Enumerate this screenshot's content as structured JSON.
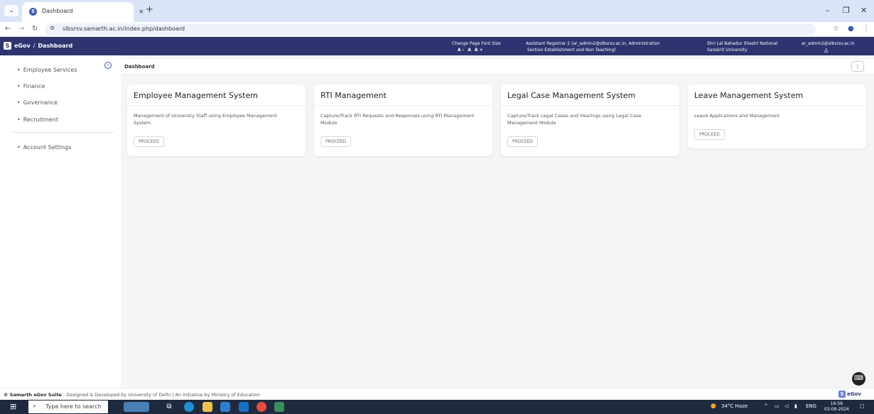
{
  "browser": {
    "tab_title": "Dashboard",
    "tab_close": "×",
    "new_tab": "+",
    "url": "slbsrsv.samarth.ac.in/index.php/dashboard",
    "icons": [
      "back-icon",
      "forward-icon",
      "reload-icon",
      "site-info-icon",
      "bookmark-star-icon",
      "profile-icon",
      "kebab-menu-icon"
    ]
  },
  "header": {
    "brand_name": "eGov",
    "brand_separator": "/",
    "page_name": "Dashboard",
    "font_size_label": "Change Page Font Size",
    "font_decrease": "A -",
    "font_reset": "A",
    "font_increase": "A +",
    "role_line1": "Assistant Registrar 2 (ar_admin2@slbsrsv.ac.in, Administration",
    "role_line2": "Section Establishment and Non Teaching)",
    "university_line1": "Shri Lal Bahadur Shastri National",
    "university_line2": "Sanskrit University",
    "user_email": "ar_admin2@slbsrsv.ac.in"
  },
  "sidebar": {
    "items": [
      {
        "label": "Employee Services"
      },
      {
        "label": "Finance"
      },
      {
        "label": "Governance"
      },
      {
        "label": "Recruitment"
      },
      {
        "label": "Account Settings"
      }
    ]
  },
  "breadcrumb": {
    "current": "Dashboard",
    "menu_glyph": "⋮"
  },
  "cards": [
    {
      "title": "Employee Management System",
      "description": "Management of University Staff using Employee Management System",
      "button": "PROCEED"
    },
    {
      "title": "RTI Management",
      "description": "Capture/Track RTI Requests and Responses using RTI Management Module",
      "button": "PROCEED"
    },
    {
      "title": "Legal Case Management System",
      "description": "Capture/Track Legal Cases and Hearings using Legal Case Management Module",
      "button": "PROCEED"
    },
    {
      "title": "Leave Management System",
      "description": "Leave Applications and Management",
      "button": "PROCEED"
    }
  ],
  "footer": {
    "brand": "© Samarth eGov Suite",
    "credit": " - Designed & Developed by University of Delhi | An Initiative by Ministry of Education",
    "badge": "eGov"
  },
  "taskbar": {
    "search_placeholder": "Type here to search",
    "weather": "34°C  Haze",
    "language": "ENG",
    "time": "16:56",
    "date": "03-09-2024"
  },
  "colors": {
    "header_bg": "#2d3470",
    "accent": "#3f57b9",
    "tabstrip_bg": "#d9e4f7",
    "taskbar_bg": "#1f2a3f",
    "page_bg": "#f5f5f5"
  }
}
